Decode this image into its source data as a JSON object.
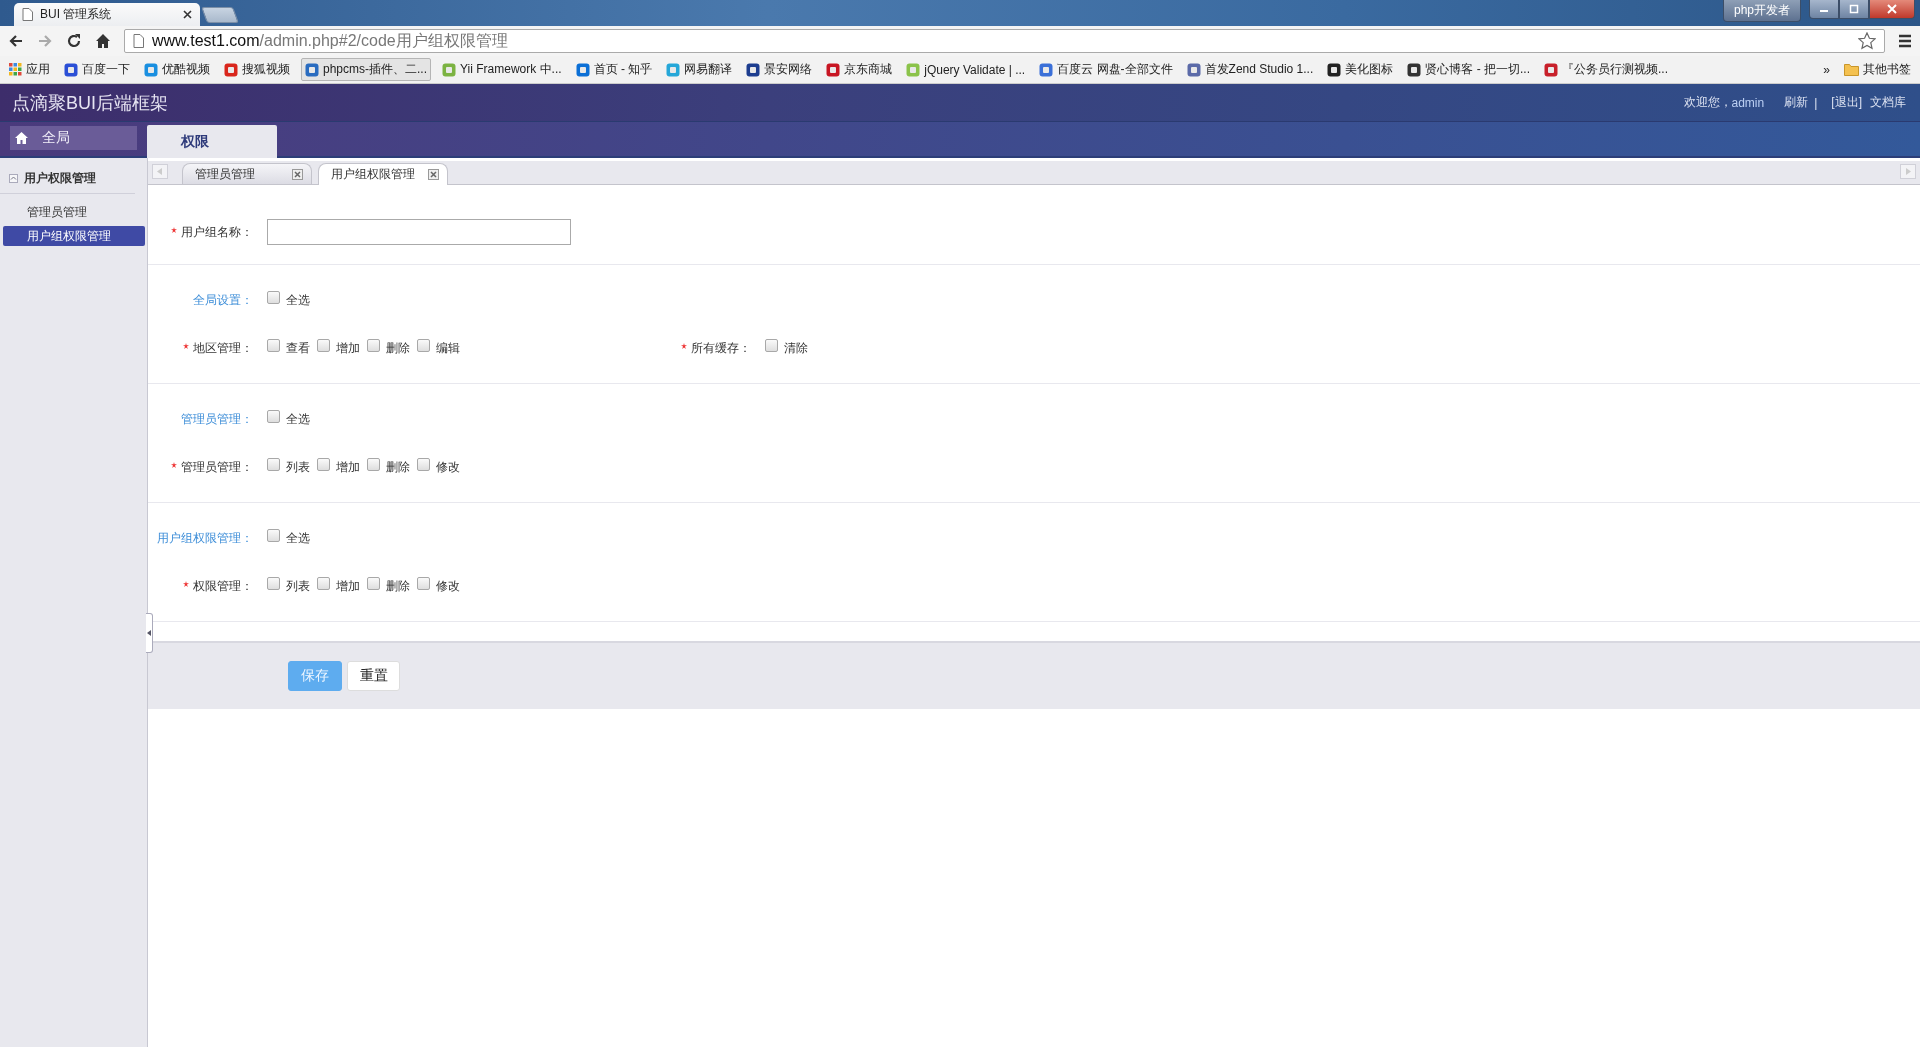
{
  "browser": {
    "tab_title": "BUI 管理系统",
    "url_host": "www.test1.com",
    "url_path": "/admin.php#2/code用户组权限管理",
    "profile": "php开发者",
    "bookmarks": [
      {
        "label": "应用",
        "kind": "apps"
      },
      {
        "label": "百度一下",
        "kind": "site",
        "color": "#2b4fd6"
      },
      {
        "label": "优酷视频",
        "kind": "site",
        "color": "#1a8fe0"
      },
      {
        "label": "搜狐视频",
        "kind": "site",
        "color": "#d9261c"
      },
      {
        "label": "phpcms-插件、二...",
        "kind": "site",
        "color": "#2a6cc0"
      },
      {
        "label": "Yii Framework 中...",
        "kind": "site",
        "color": "#7cb342"
      },
      {
        "label": "首页 - 知乎",
        "kind": "site",
        "color": "#0b6fd6"
      },
      {
        "label": "网易翻译",
        "kind": "site",
        "color": "#25a7d8"
      },
      {
        "label": "景安网络",
        "kind": "site",
        "color": "#1d3d8f"
      },
      {
        "label": "京东商城",
        "kind": "site",
        "color": "#c81623"
      },
      {
        "label": "jQuery Validate | ...",
        "kind": "site",
        "color": "#8bc34a"
      },
      {
        "label": "百度云 网盘-全部文件",
        "kind": "site",
        "color": "#3a6fd8"
      },
      {
        "label": "首发Zend Studio 1...",
        "kind": "site",
        "color": "#5b6aa8"
      },
      {
        "label": "美化图标",
        "kind": "site",
        "color": "#222222"
      },
      {
        "label": "贤心博客 - 把一切...",
        "kind": "site",
        "color": "#333333"
      },
      {
        "label": "『公务员行测视频...",
        "kind": "site",
        "color": "#c8202a"
      }
    ],
    "overflow": "»",
    "other_bookmarks": "其他书签"
  },
  "header": {
    "title": "点滴聚BUI后端框架",
    "welcome": "欢迎您，",
    "user": "admin",
    "links": [
      {
        "label": "刷新",
        "kind": "link"
      },
      {
        "label": "|",
        "kind": "separator"
      },
      {
        "label": "[退出]",
        "kind": "link"
      },
      {
        "label": "文档库",
        "kind": "link"
      }
    ]
  },
  "nav": [
    {
      "label": "全局",
      "selected": false
    },
    {
      "label": "权限",
      "selected": true
    }
  ],
  "sidebar": {
    "group": "用户权限管理",
    "expanded": true,
    "items": [
      {
        "label": "管理员管理",
        "selected": false
      },
      {
        "label": "用户组权限管理",
        "selected": true
      }
    ]
  },
  "page_tabs": [
    {
      "label": "管理员管理",
      "selected": false
    },
    {
      "label": "用户组权限管理",
      "selected": true
    }
  ],
  "form": {
    "name_field": {
      "label": "用户组名称：",
      "required": true
    },
    "sections": [
      {
        "title": "全局设置：",
        "select_all": {
          "label": "全选",
          "checked": false
        },
        "rows": [
          {
            "groups": [
              {
                "label": "地区管理：",
                "required": true,
                "options": [
                  {
                    "label": "查看",
                    "checked": false
                  },
                  {
                    "label": "增加",
                    "checked": false
                  },
                  {
                    "label": "删除",
                    "checked": false
                  },
                  {
                    "label": "编辑",
                    "checked": false
                  }
                ]
              },
              {
                "label": "所有缓存：",
                "required": true,
                "options": [
                  {
                    "label": "清除",
                    "checked": false
                  }
                ]
              }
            ]
          }
        ]
      },
      {
        "title": "管理员管理：",
        "select_all": {
          "label": "全选",
          "checked": false
        },
        "rows": [
          {
            "groups": [
              {
                "label": "管理员管理：",
                "required": true,
                "options": [
                  {
                    "label": "列表",
                    "checked": false
                  },
                  {
                    "label": "增加",
                    "checked": false
                  },
                  {
                    "label": "删除",
                    "checked": false
                  },
                  {
                    "label": "修改",
                    "checked": false
                  }
                ]
              }
            ]
          }
        ]
      },
      {
        "title": "用户组权限管理：",
        "select_all": {
          "label": "全选",
          "checked": false
        },
        "rows": [
          {
            "groups": [
              {
                "label": "权限管理：",
                "required": true,
                "options": [
                  {
                    "label": "列表",
                    "checked": false
                  },
                  {
                    "label": "增加",
                    "checked": false
                  },
                  {
                    "label": "删除",
                    "checked": false
                  },
                  {
                    "label": "修改",
                    "checked": false
                  }
                ]
              }
            ]
          }
        ]
      }
    ],
    "buttons": [
      {
        "label": "保存",
        "kind": "primary"
      },
      {
        "label": "重置",
        "kind": "default"
      }
    ]
  }
}
